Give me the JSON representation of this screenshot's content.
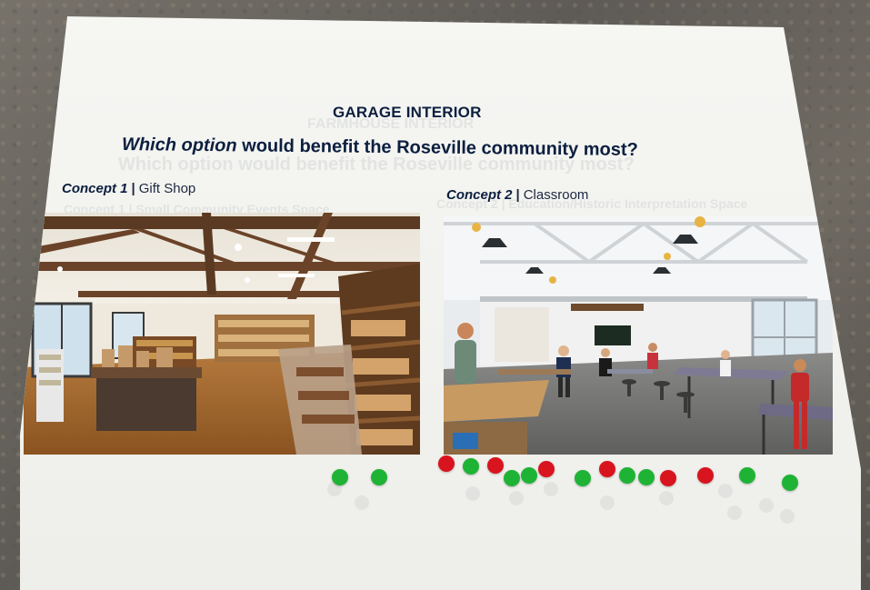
{
  "colors": {
    "navy": "#0c1f3f",
    "dot_green": "#1fb335",
    "dot_red": "#d8141e",
    "poster": "#f4f4f1",
    "table": "#2d3c4a"
  },
  "poster": {
    "title": "GARAGE INTERIOR",
    "question_emphasis": "Which option",
    "question_rest": " would benefit the Roseville community most?",
    "show_through": {
      "title": "FARMHOUSE INTERIOR",
      "question": "Which option would benefit the Roseville community most?",
      "concept1": "Concept 1 | Small Community Events Space",
      "concept2": "Concept 2 | Education/Historic Interpretation Space"
    }
  },
  "concepts": [
    {
      "number": "Concept 1",
      "separator": "|",
      "name": "Gift Shop",
      "photo_icon": "gift-shop-interior-photo"
    },
    {
      "number": "Concept 2",
      "separator": "|",
      "name": "Classroom",
      "photo_icon": "classroom-interior-photo"
    }
  ],
  "votes": {
    "concept1": [
      "green",
      "green"
    ],
    "concept2": [
      "red",
      "green",
      "red",
      "green",
      "green",
      "red",
      "green",
      "red",
      "green",
      "green",
      "red",
      "red",
      "green",
      "green"
    ],
    "totals": {
      "concept1": {
        "green": 2,
        "red": 0
      },
      "concept2": {
        "green": 8,
        "red": 6
      }
    }
  }
}
